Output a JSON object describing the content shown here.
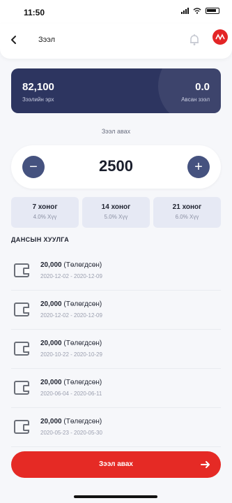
{
  "status": {
    "time": "11:50"
  },
  "header": {
    "title": "Зээл",
    "logo": ""
  },
  "summary": {
    "left_value": "82,100",
    "left_label": "Зээлийн эрх",
    "right_value": "0.0",
    "right_label": "Авсан зээл"
  },
  "loan_input": {
    "label": "Зээл авах",
    "value": "2500",
    "minus": "−",
    "plus": "+"
  },
  "terms": [
    {
      "title": "7 хоног",
      "rate": "4.0% Хүү"
    },
    {
      "title": "14 хоног",
      "rate": "5.0% Хүү"
    },
    {
      "title": "21 хоног",
      "rate": "6.0% Хүү"
    }
  ],
  "history": {
    "title": "ДАНСЫН ХУУЛГА",
    "items": [
      {
        "amount": "20,000",
        "note": "(Төлөгдсөн)",
        "dates": "2020-12-02 - 2020-12-09"
      },
      {
        "amount": "20,000",
        "note": "(Төлөгдсөн)",
        "dates": "2020-12-02 - 2020-12-09"
      },
      {
        "amount": "20,000",
        "note": "(Төлөгдсөн)",
        "dates": "2020-10-22 - 2020-10-29"
      },
      {
        "amount": "20,000",
        "note": "(Төлөгдсөн)",
        "dates": "2020-06-04 - 2020-06-11"
      },
      {
        "amount": "20,000",
        "note": "(Төлөгдсөн)",
        "dates": "2020-05-23 - 2020-05-30"
      }
    ]
  },
  "cta": {
    "label": "Зээл авах"
  },
  "colors": {
    "primary_dark": "#2d3560",
    "accent_red": "#e52a25",
    "stepper_btn": "#45527f"
  }
}
